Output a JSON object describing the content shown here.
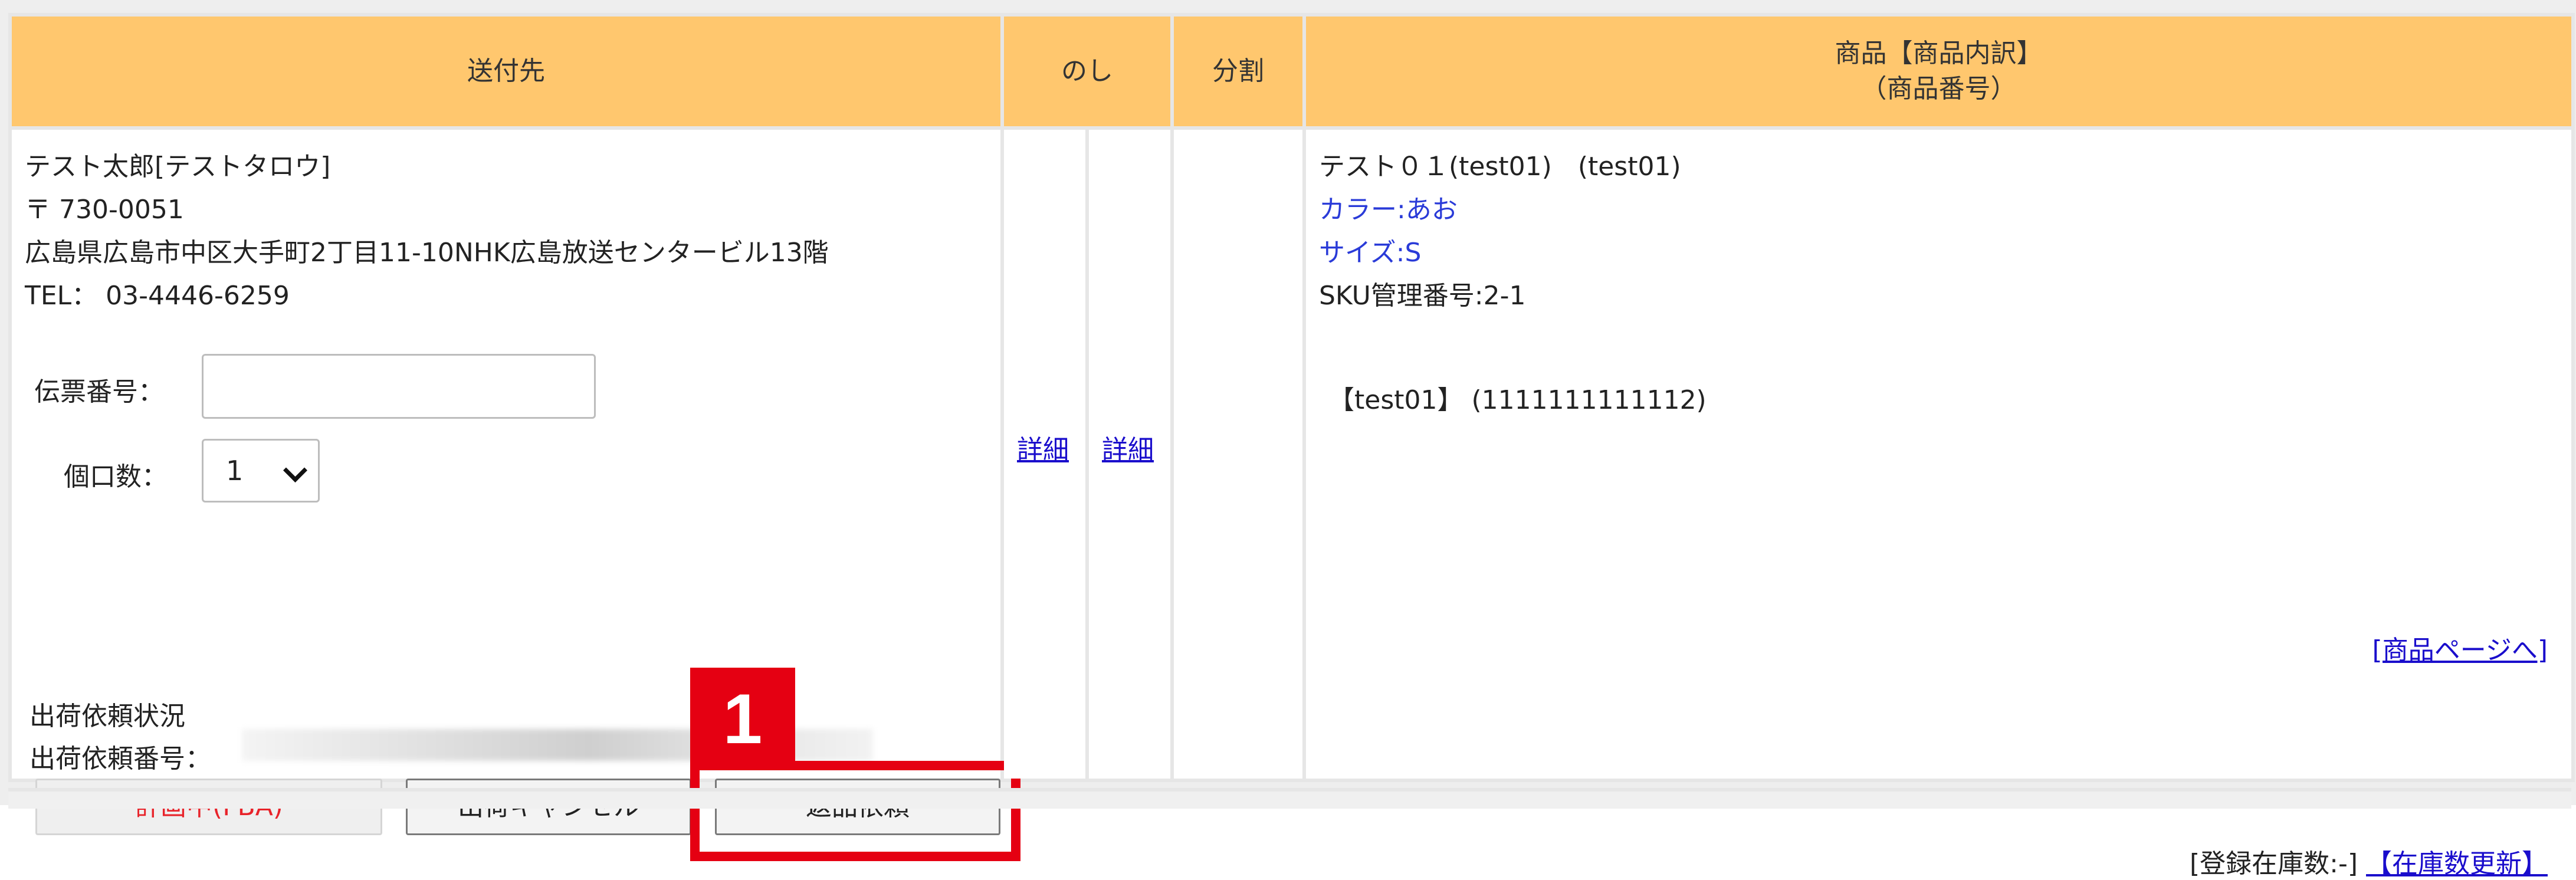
{
  "headers": {
    "destination": "送付先",
    "noshi": "のし",
    "split": "分割",
    "product_line1": "商品【商品内訳】",
    "product_line2": "（商品番号）"
  },
  "address": {
    "name": "テスト太郎[テストタロウ]",
    "postal": "〒 730-0051",
    "street": "広島県広島市中区大手町2丁目11-10NHK広島放送センタービル13階",
    "tel": "TEL： 03-4446-6259"
  },
  "form": {
    "slip_label": "伝票番号：",
    "slip_value": "",
    "qty_label": "個口数：",
    "qty_value": "1"
  },
  "shipment": {
    "status_label": "出荷依頼状況",
    "number_label": "出荷依頼番号："
  },
  "buttons": {
    "planning": "計画中(FBA)",
    "cancel": "出荷キャンセル",
    "return": "返品依頼"
  },
  "annotation": {
    "badge": "1",
    "color": "#e50012"
  },
  "noshi_links": {
    "detail1": "詳細",
    "detail2": "詳細"
  },
  "product": {
    "name": "テスト０１(test01)　(test01)",
    "color": "カラー:あお",
    "size": "サイズ:S",
    "sku": "SKU管理番号:2-1",
    "code": "【test01】 (1111111111112)",
    "page_link": "[商品ページへ]",
    "stock_label": "[登録在庫数:-]",
    "stock_update": "【在庫数更新】"
  },
  "colors": {
    "header_bg": "#ffc76e",
    "link": "#1a0dcc",
    "variant_text": "#2a3bd8",
    "planning_text": "#e8232a"
  }
}
